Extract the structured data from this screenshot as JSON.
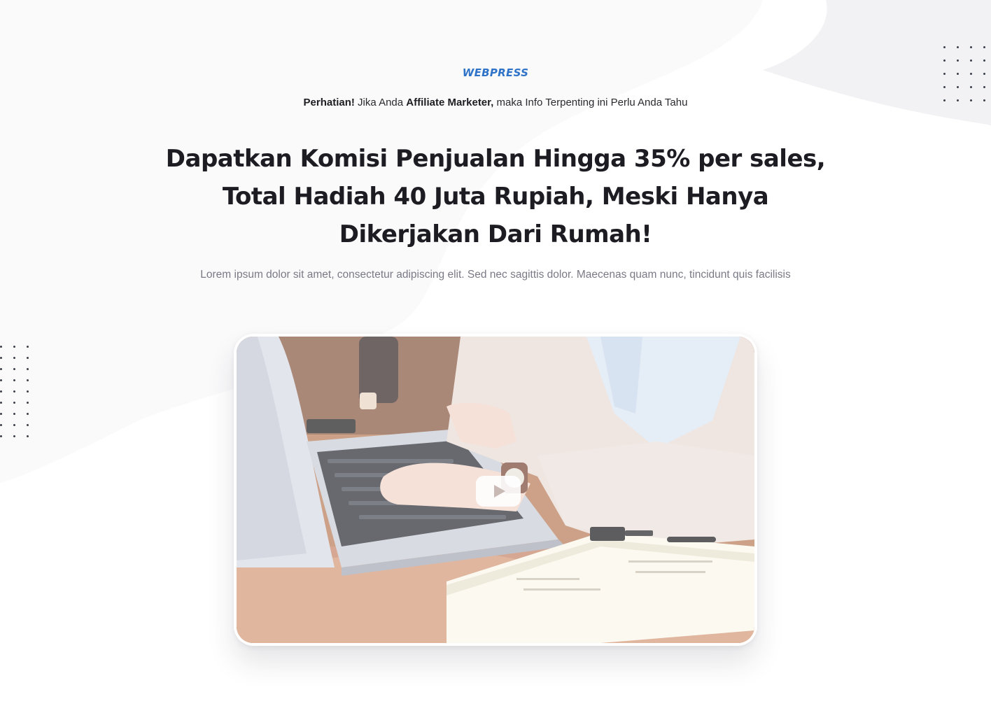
{
  "header": {
    "brand": "WEBPRESS",
    "notice_bold_1": "Perhatian!",
    "notice_text_1": " Jika Anda ",
    "notice_bold_2": "Affiliate Marketer,",
    "notice_text_2": " maka Info Terpenting ini Perlu Anda Tahu"
  },
  "hero": {
    "headline_line_1": "Dapatkan Komisi Penjualan Hingga 35% per sales,",
    "headline_line_2": "Total Hadiah 40 Juta Rupiah, Meski Hanya",
    "headline_line_3": "Dikerjakan Dari Rumah!",
    "subtext": "Lorem ipsum dolor sit amet, consectetur adipiscing elit. Sed nec sagittis dolor. Maecenas quam nunc, tincidunt quis facilisis"
  },
  "video": {
    "play_icon": "play-icon"
  },
  "colors": {
    "brand": "#2e73c8",
    "headline": "#1c1c22",
    "subtext": "#7a7a86"
  }
}
